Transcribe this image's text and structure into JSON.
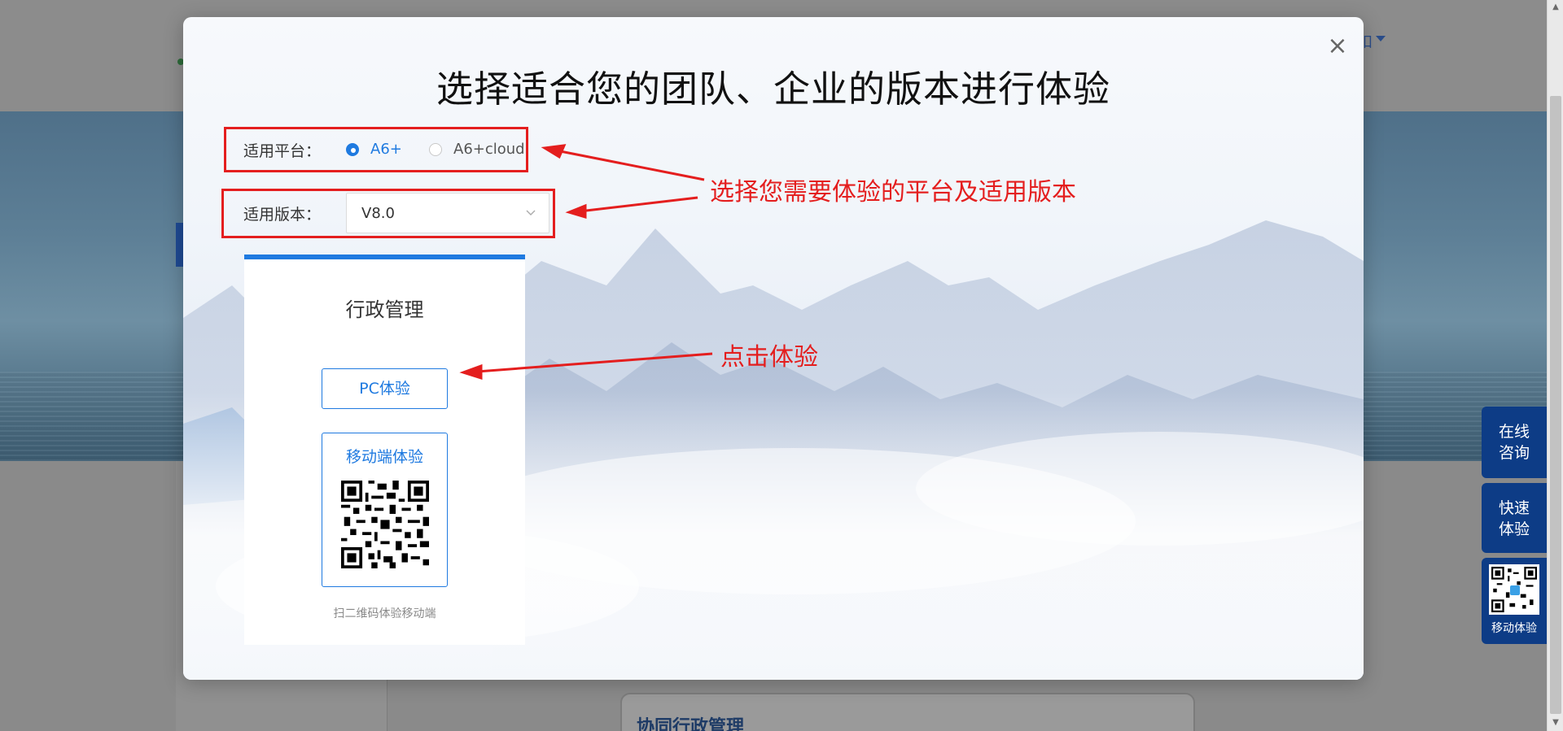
{
  "background": {
    "header_link": "扣",
    "card_title": "协同行政管理"
  },
  "side_tools": {
    "consult": "在线\n咨询",
    "quick": "快速\n体验",
    "mobile": "移动体验"
  },
  "modal": {
    "title": "选择适合您的团队、企业的版本进行体验",
    "close_icon": "×",
    "platform": {
      "label": "适用平台：",
      "options": [
        {
          "label": "A6+",
          "checked": true
        },
        {
          "label": "A6+cloud",
          "checked": false
        }
      ]
    },
    "version": {
      "label": "适用版本：",
      "selected": "V8.0"
    },
    "card": {
      "title": "行政管理",
      "pc_button": "PC体验",
      "mobile_button": "移动端体验",
      "hint": "扫二维码体验移动端"
    },
    "annotations": {
      "select_hint": "选择您需要体验的平台及适用版本",
      "click_hint": "点击体验"
    }
  },
  "colors": {
    "accent": "#1f7ae0",
    "annotation": "#e41e1e",
    "side_tool": "#0d3c86"
  }
}
